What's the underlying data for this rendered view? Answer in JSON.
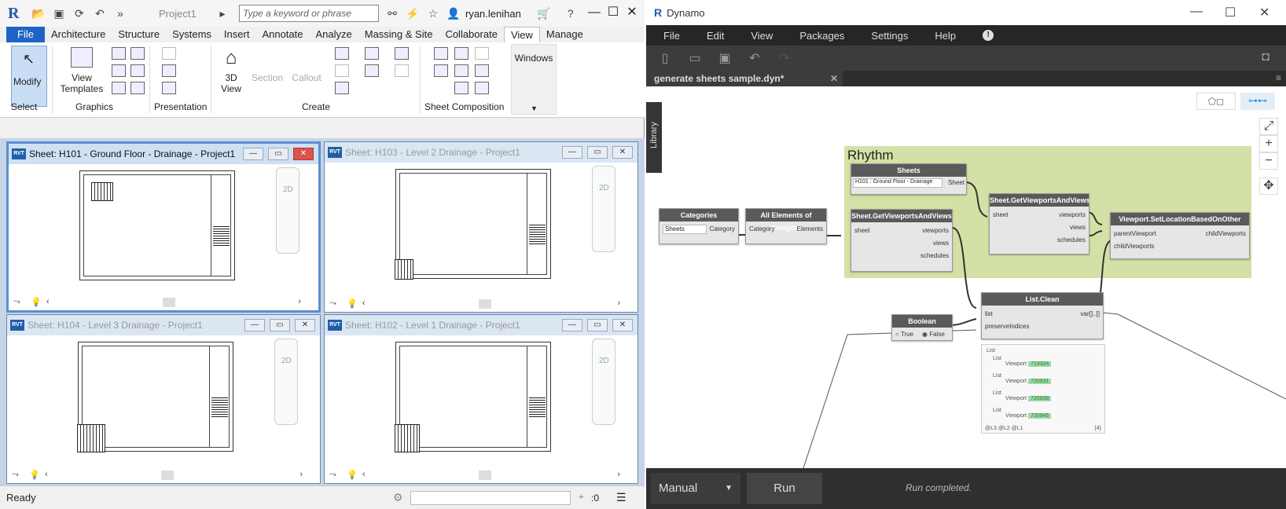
{
  "revit": {
    "project_title": "Project1",
    "search_placeholder": "Type a keyword or phrase",
    "user": "ryan.lenihan",
    "tabs": [
      "File",
      "Architecture",
      "Structure",
      "Systems",
      "Insert",
      "Annotate",
      "Analyze",
      "Massing & Site",
      "Collaborate",
      "View",
      "Manage"
    ],
    "ribbon": {
      "modify": "Modify",
      "view_templates": "View Templates",
      "three_d_view": "3D View",
      "section": "Section",
      "callout": "Callout",
      "windows": "Windows",
      "panels": [
        "Select",
        "Graphics",
        "Presentation",
        "Create",
        "Sheet Composition"
      ]
    },
    "views": [
      {
        "title": "Sheet: H101 - Ground Floor - Drainage - Project1"
      },
      {
        "title": "Sheet: H103 - Level 2 Drainage - Project1"
      },
      {
        "title": "Sheet: H104 - Level 3 Drainage - Project1"
      },
      {
        "title": "Sheet: H102 - Level 1 Drainage - Project1"
      }
    ],
    "nav_2d": "2D",
    "status": "Ready",
    "status_zero": ":0"
  },
  "dynamo": {
    "title": "Dynamo",
    "menu": [
      "File",
      "Edit",
      "View",
      "Packages",
      "Settings",
      "Help"
    ],
    "tab": "generate sheets sample.dyn*",
    "library": "Library",
    "group_title": "Rhythm",
    "nodes": {
      "categories": {
        "title": "Categories",
        "value": "Sheets",
        "out": "Category"
      },
      "all_elements": {
        "title": "All Elements of Category",
        "in": "Category",
        "out": "Elements"
      },
      "sheets": {
        "title": "Sheets",
        "value": "H101 : Ground Floor - Drainage",
        "out": "Sheet"
      },
      "get_vv_1": {
        "title": "Sheet.GetViewportsAndViews",
        "in": "sheet",
        "out1": "viewports",
        "out2": "views",
        "out3": "schedules"
      },
      "get_vv_2": {
        "title": "Sheet.GetViewportsAndViews",
        "in": "sheet",
        "out1": "viewports",
        "out2": "views",
        "out3": "schedules"
      },
      "set_location": {
        "title": "Viewport.SetLocationBasedOnOther",
        "in1": "parentViewport",
        "in2": "childViewports",
        "out": "childViewports"
      },
      "list_clean": {
        "title": "List.Clean",
        "in1": "list",
        "in2": "preserveIndices",
        "out": "var[]..[]"
      },
      "boolean": {
        "title": "Boolean",
        "opt_true": "True",
        "opt_false": "False"
      }
    },
    "preview": {
      "root": "List",
      "groups": [
        {
          "label": "List",
          "item": "Viewport",
          "id": "719324"
        },
        {
          "label": "List",
          "item": "Viewport",
          "id": "720931"
        },
        {
          "label": "List",
          "item": "Viewport",
          "id": "720938"
        },
        {
          "label": "List",
          "item": "Viewport",
          "id": "720945"
        }
      ],
      "footer_left": "@L3 @L2 @L1",
      "footer_right": "{4}"
    },
    "run_mode": "Manual",
    "run_label": "Run",
    "run_status": "Run completed."
  }
}
